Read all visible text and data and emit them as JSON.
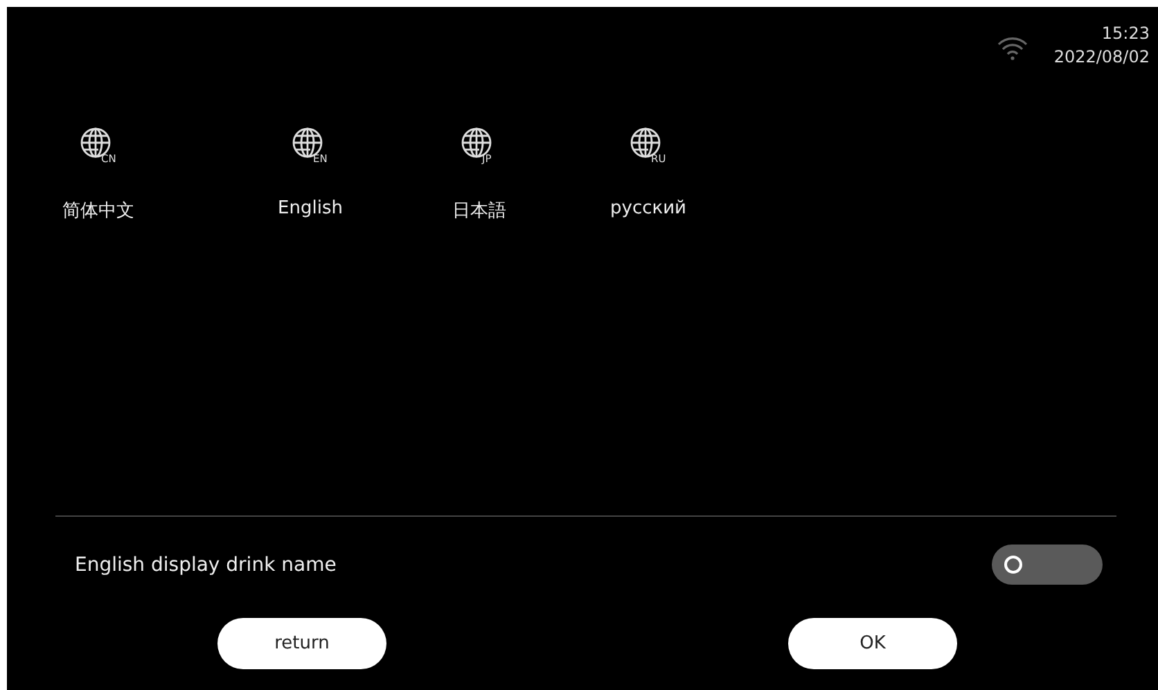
{
  "status_bar": {
    "time": "15:23",
    "date": "2022/08/02"
  },
  "languages": [
    {
      "label": "简体中文",
      "badge": "CN"
    },
    {
      "label": "English",
      "badge": "EN"
    },
    {
      "label": "日本語",
      "badge": "JP"
    },
    {
      "label": "русский",
      "badge": "RU"
    }
  ],
  "setting": {
    "label": "English display drink name",
    "on": false
  },
  "buttons": [
    "return",
    "OK"
  ]
}
